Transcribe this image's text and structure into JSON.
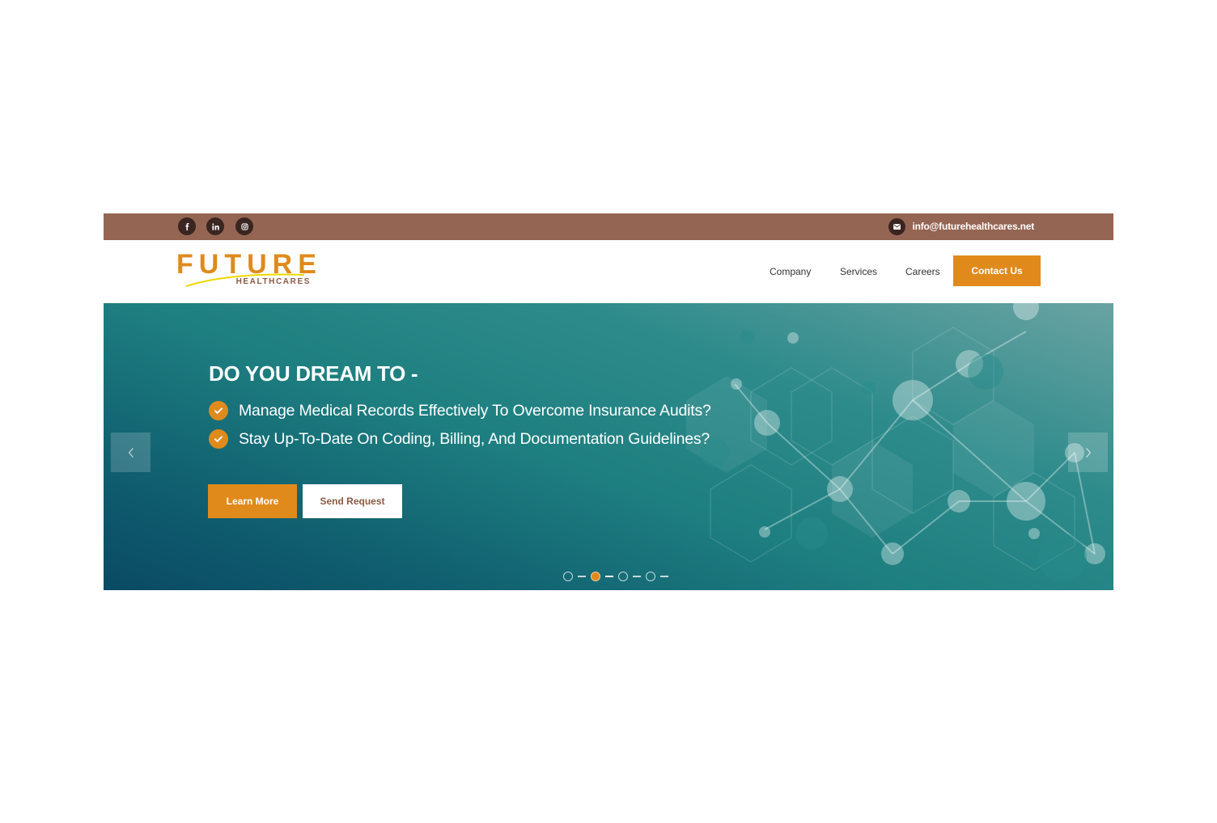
{
  "topbar": {
    "socials": [
      {
        "icon": "facebook-icon"
      },
      {
        "icon": "linkedin-icon"
      },
      {
        "icon": "instagram-icon"
      }
    ],
    "email": "info@futurehealthcares.net"
  },
  "logo": {
    "main": "FUTURE",
    "sub": "HEALTHCARES"
  },
  "nav": {
    "items": [
      "Company",
      "Services",
      "Careers"
    ],
    "contact_label": "Contact Us"
  },
  "hero": {
    "title": "DO YOU DREAM TO -",
    "bullets": [
      "Manage Medical Records Effectively To Overcome Insurance Audits?",
      "Stay Up-To-Date On Coding, Billing, And Documentation Guidelines?"
    ],
    "learn_more_label": "Learn More",
    "send_request_label": "Send Request",
    "slides_total": 4,
    "active_slide": 2
  },
  "colors": {
    "topbar": "#956553",
    "accent": "#e08a1c",
    "brown_text": "#8a5a44",
    "hero_teal": "#1e7f80"
  }
}
